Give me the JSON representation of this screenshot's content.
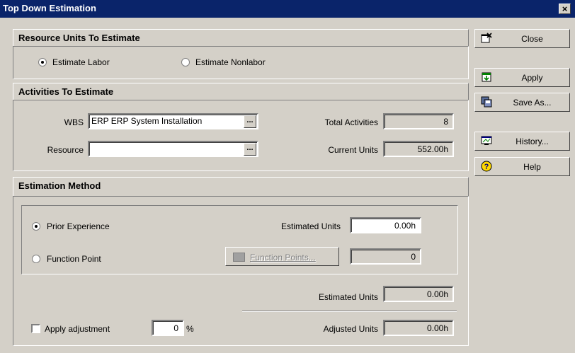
{
  "window": {
    "title": "Top Down Estimation",
    "close_glyph": "×"
  },
  "resource_units": {
    "header": "Resource Units To Estimate",
    "options": [
      {
        "label": "Estimate Labor",
        "selected": true
      },
      {
        "label": "Estimate Nonlabor",
        "selected": false
      }
    ]
  },
  "activities": {
    "header": "Activities To Estimate",
    "wbs_label": "WBS",
    "wbs_value": "ERP  ERP System Installation",
    "resource_label": "Resource",
    "resource_value": "",
    "browse_label": "...",
    "total_activities_label": "Total Activities",
    "total_activities_value": "8",
    "current_units_label": "Current Units",
    "current_units_value": "552.00h"
  },
  "method": {
    "header": "Estimation Method",
    "options": [
      {
        "label": "Prior Experience",
        "selected": true
      },
      {
        "label": "Function Point",
        "selected": false
      }
    ],
    "estimated_units_label": "Estimated Units",
    "estimated_units_value": "0.00h",
    "function_points_button": "Function Points...",
    "function_points_value": "0",
    "estimated_units_total_label": "Estimated Units",
    "estimated_units_total_value": "0.00h",
    "apply_adjustment_label": "Apply adjustment",
    "apply_adjustment_checked": false,
    "adjustment_value": "0",
    "adjustment_unit": "%",
    "adjusted_units_label": "Adjusted Units",
    "adjusted_units_value": "0.00h"
  },
  "buttons": {
    "close": "Close",
    "apply": "Apply",
    "save_as": "Save As...",
    "history": "History...",
    "help": "Help"
  },
  "icons": {
    "close": "window-close-icon",
    "apply": "apply-icon",
    "save_as": "save-as-icon",
    "history": "history-icon",
    "help": "help-icon"
  },
  "colors": {
    "titlebar": "#0a246a",
    "face": "#d4d0c8"
  }
}
